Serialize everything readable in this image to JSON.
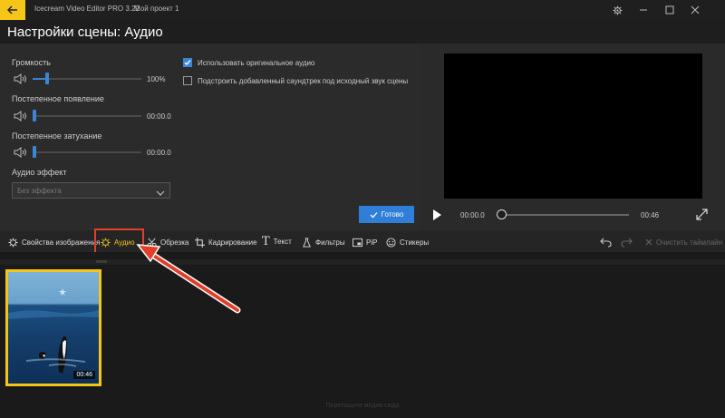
{
  "window": {
    "app_title": "Icecream Video Editor PRO 3.22",
    "project_title": "Мой проект 1"
  },
  "page": {
    "title": "Настройки сцены: Аудио"
  },
  "audio_settings": {
    "volume_label": "Громкость",
    "volume_value": "100%",
    "volume_level": 0.12,
    "fade_in_label": "Постепенное появление",
    "fade_in_value": "00:00.0",
    "fade_out_label": "Постепенное затухание",
    "fade_out_value": "00:00.0",
    "effect_label": "Аудио эффект",
    "effect_selected": "Без эффекта",
    "use_original_label": "Использовать оригинальное аудио",
    "use_original_checked": true,
    "fit_soundtrack_label": "Подстроить добавленный саундтрек под исходный звук сцены",
    "fit_soundtrack_checked": false,
    "done_label": "Готово"
  },
  "player": {
    "current_time": "00:00.0",
    "duration": "00:46"
  },
  "toolbar": {
    "image_props": "Свойства изображения",
    "audio": "Аудио",
    "trim": "Обрезка",
    "crop": "Кадрирование",
    "text": "Текст",
    "filters": "Фильтры",
    "pip": "PiP",
    "stickers": "Стикеры",
    "clear": "Очистить таймлайн"
  },
  "timeline": {
    "clip_duration": "00:46",
    "drop_hint": "Перетащите медиа сюда"
  },
  "colors": {
    "accent": "#f5c518",
    "primary": "#2f7ed8",
    "highlight": "#e0402a"
  }
}
